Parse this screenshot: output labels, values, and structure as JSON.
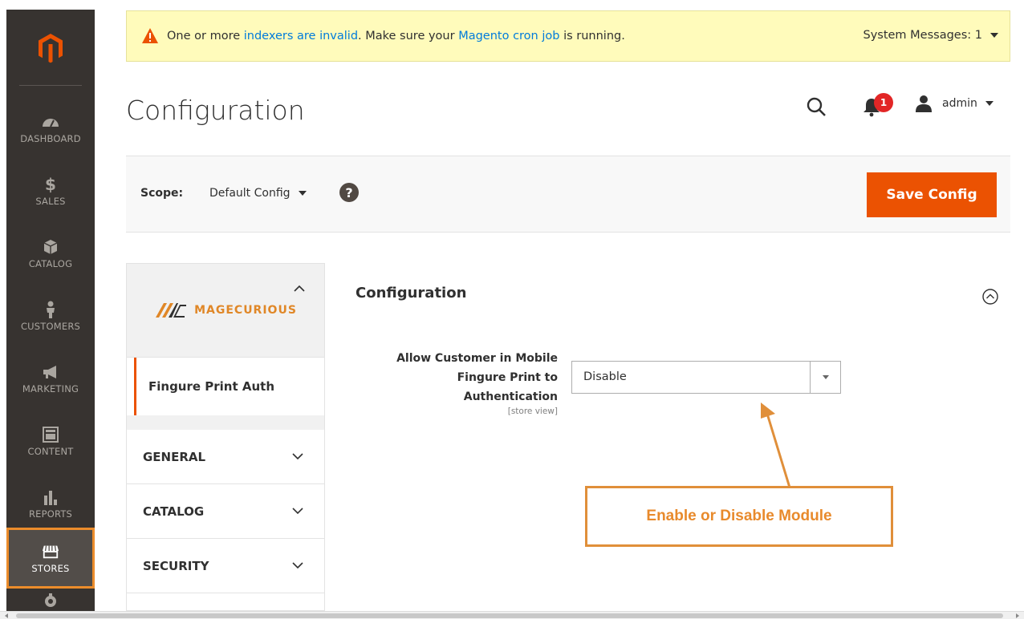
{
  "sidebar": {
    "items": [
      {
        "label": "DASHBOARD",
        "icon": "dashboard-icon"
      },
      {
        "label": "SALES",
        "icon": "dollar-icon"
      },
      {
        "label": "CATALOG",
        "icon": "box-icon"
      },
      {
        "label": "CUSTOMERS",
        "icon": "person-icon"
      },
      {
        "label": "MARKETING",
        "icon": "megaphone-icon"
      },
      {
        "label": "CONTENT",
        "icon": "layout-icon"
      },
      {
        "label": "REPORTS",
        "icon": "bar-chart-icon"
      },
      {
        "label": "STORES",
        "icon": "store-icon",
        "active": true
      }
    ]
  },
  "message": {
    "part1": "One or more ",
    "link1": "indexers are invalid",
    "part2": ". Make sure your ",
    "link2": "Magento cron job",
    "part3": " is running.",
    "system_messages": "System Messages: 1"
  },
  "header": {
    "title": "Configuration",
    "notification_count": "1",
    "user": "admin"
  },
  "scope": {
    "label": "Scope:",
    "value": "Default Config",
    "help": "?"
  },
  "toolbar": {
    "save_label": "Save Config"
  },
  "tabs": {
    "brand": "MAGECURIOUS",
    "active_item": "Fingure Print Auth",
    "sections": [
      "GENERAL",
      "CATALOG",
      "SECURITY"
    ]
  },
  "section": {
    "title": "Configuration"
  },
  "field": {
    "label_line1": "Allow Customer in Mobile",
    "label_line2": "Fingure Print to",
    "label_line3": "Authentication",
    "scope": "[store view]",
    "value": "Disable"
  },
  "annotation": {
    "text": "Enable or Disable Module"
  },
  "colors": {
    "accent": "#eb5202",
    "sidebar_bg": "#373330",
    "annotation": "#e08f3a",
    "link": "#007bdb"
  }
}
